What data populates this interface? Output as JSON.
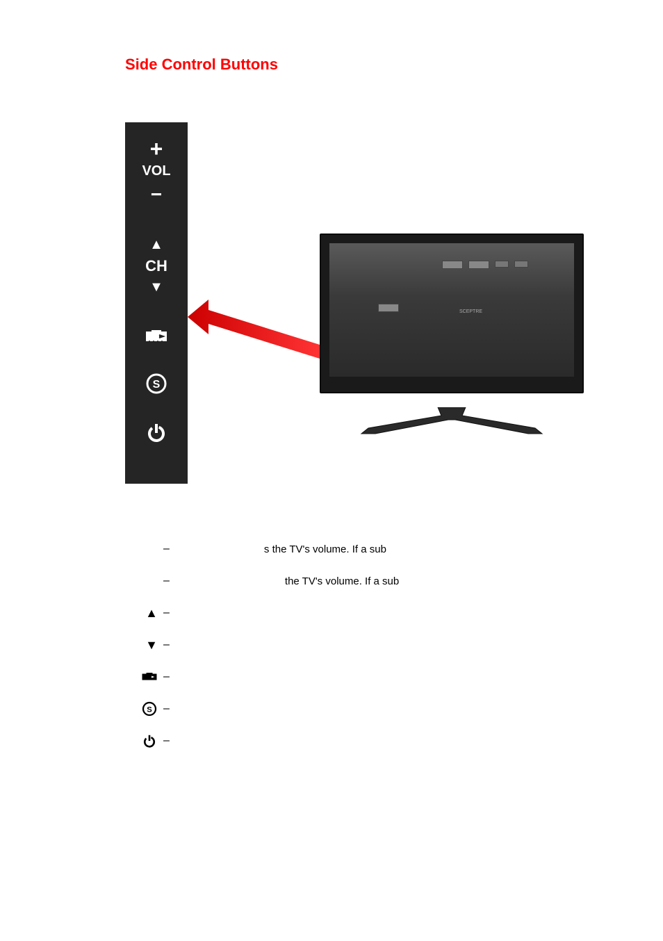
{
  "title": "Side Control Buttons",
  "panel": {
    "plus": "+",
    "vol": "VOL",
    "minus": "−",
    "up": "▲",
    "ch": "CH",
    "down": "▼"
  },
  "descriptions": {
    "vol_up": {
      "dash": "–",
      "text": "s the TV's volume.  If a sub"
    },
    "vol_down": {
      "dash": "–",
      "text": "the TV's volume.  If a sub"
    },
    "ch_up": {
      "symbol": "▲",
      "dash": "–",
      "text": ""
    },
    "ch_down": {
      "symbol": "▼",
      "dash": "–",
      "text": ""
    },
    "input": {
      "dash": "–",
      "text": ""
    },
    "source": {
      "dash": "–",
      "text": ""
    },
    "power": {
      "dash": "–",
      "text": ""
    }
  },
  "tv": {
    "brand": "SCEPTRE"
  }
}
